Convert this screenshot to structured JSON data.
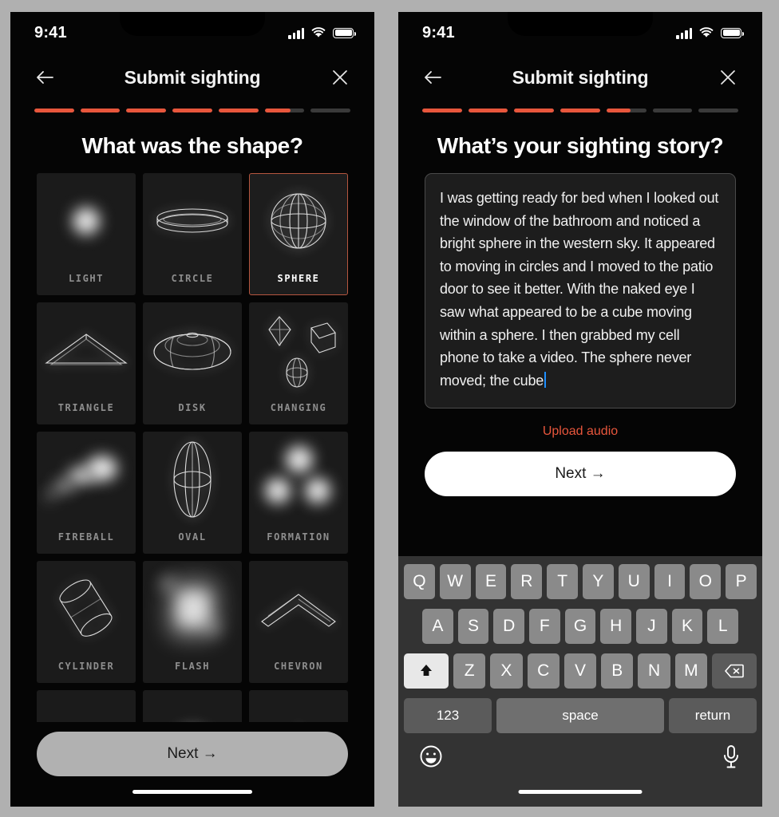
{
  "left_phone": {
    "status": {
      "time": "9:41",
      "signal_icon": "cellular-bars-icon",
      "wifi_icon": "wifi-icon",
      "battery_icon": "battery-full-icon"
    },
    "nav": {
      "back_icon": "arrow-left-icon",
      "title": "Submit sighting",
      "close_icon": "close-x-icon"
    },
    "progress": {
      "segments": 7,
      "fills": [
        100,
        100,
        100,
        100,
        100,
        65,
        0
      ],
      "accent_color": "#e8563c",
      "track_color": "#3a3a3a"
    },
    "question": "What was the shape?",
    "shapes": [
      {
        "label": "LIGHT",
        "art": "light-glow-icon",
        "selected": false
      },
      {
        "label": "CIRCLE",
        "art": "circle-disc-icon",
        "selected": false
      },
      {
        "label": "SPHERE",
        "art": "sphere-wireframe-icon",
        "selected": true
      },
      {
        "label": "TRIANGLE",
        "art": "triangle-wireframe-icon",
        "selected": false
      },
      {
        "label": "DISK",
        "art": "disk-wireframe-icon",
        "selected": false
      },
      {
        "label": "CHANGING",
        "art": "changing-shapes-icon",
        "selected": false
      },
      {
        "label": "FIREBALL",
        "art": "fireball-glow-icon",
        "selected": false
      },
      {
        "label": "OVAL",
        "art": "oval-wireframe-icon",
        "selected": false
      },
      {
        "label": "FORMATION",
        "art": "formation-glow-icon",
        "selected": false
      },
      {
        "label": "CYLINDER",
        "art": "cylinder-wireframe-icon",
        "selected": false
      },
      {
        "label": "FLASH",
        "art": "flash-glow-icon",
        "selected": false
      },
      {
        "label": "CHEVRON",
        "art": "chevron-wireframe-icon",
        "selected": false
      }
    ],
    "cta": {
      "label": "Next →",
      "style": "grey"
    }
  },
  "right_phone": {
    "status": {
      "time": "9:41",
      "signal_icon": "cellular-bars-icon",
      "wifi_icon": "wifi-icon",
      "battery_icon": "battery-full-icon"
    },
    "nav": {
      "back_icon": "arrow-left-icon",
      "title": "Submit sighting",
      "close_icon": "close-x-icon"
    },
    "progress": {
      "segments": 7,
      "fills": [
        100,
        100,
        100,
        100,
        60,
        0,
        0
      ],
      "accent_color": "#e8563c",
      "track_color": "#3a3a3a"
    },
    "question": "What’s your sighting story?",
    "story": {
      "value": "I was getting ready for bed when I looked out the window of the bathroom and noticed a bright sphere in the western sky. It appeared to moving in circles and I moved to the patio door to see it better. With the naked eye I saw what appeared to be a cube moving within a sphere. I then grabbed my cell phone to take a video. The sphere never moved; the cube",
      "placeholder": "",
      "caret_color": "#1e8fff"
    },
    "upload_audio_label": "Upload audio",
    "cta": {
      "label": "Next →",
      "style": "white"
    },
    "keyboard": {
      "row1": [
        "Q",
        "W",
        "E",
        "R",
        "T",
        "Y",
        "U",
        "I",
        "O",
        "P"
      ],
      "row2": [
        "A",
        "S",
        "D",
        "F",
        "G",
        "H",
        "J",
        "K",
        "L"
      ],
      "row3": [
        "Z",
        "X",
        "C",
        "V",
        "B",
        "N",
        "M"
      ],
      "shift_icon": "shift-up-arrow-icon",
      "delete_icon": "backspace-delete-icon",
      "numbers_label": "123",
      "space_label": "space",
      "return_label": "return",
      "emoji_icon": "emoji-smiley-icon",
      "mic_icon": "microphone-icon"
    }
  }
}
